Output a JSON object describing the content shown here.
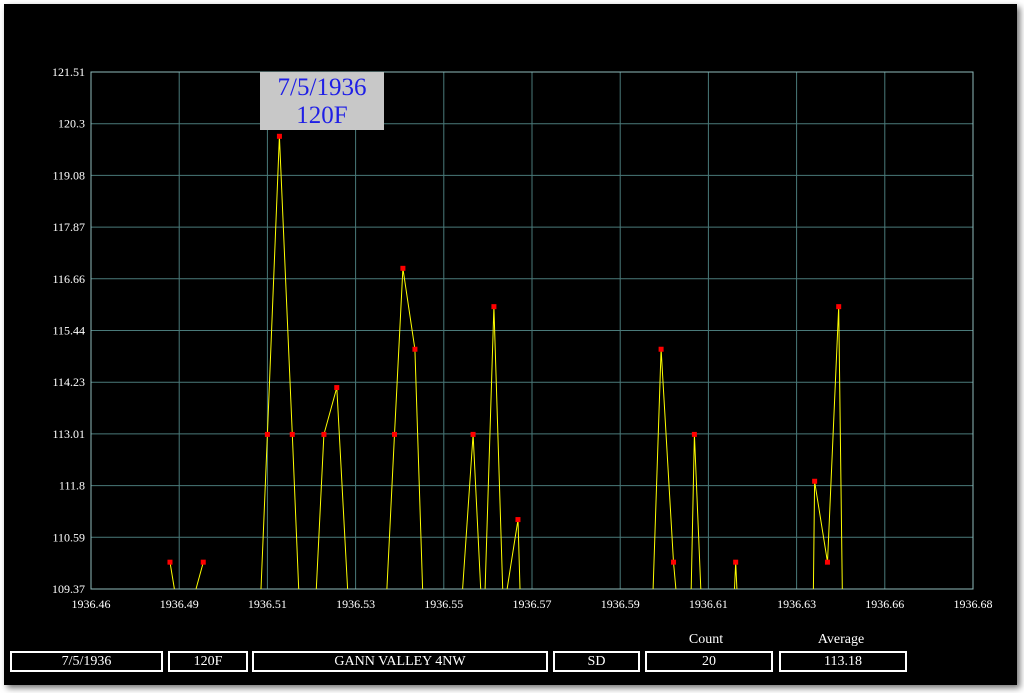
{
  "chart_data": {
    "type": "line",
    "title": "",
    "xlabel": "",
    "ylabel": "",
    "xlim": [
      1936.46,
      1936.68
    ],
    "ylim": [
      109.37,
      121.51
    ],
    "x_ticks": [
      "1936.46",
      "1936.49",
      "1936.51",
      "1936.53",
      "1936.55",
      "1936.57",
      "1936.59",
      "1936.61",
      "1936.63",
      "1936.66",
      "1936.68"
    ],
    "y_ticks": [
      "109.37",
      "110.59",
      "111.8",
      "113.01",
      "114.23",
      "115.44",
      "116.66",
      "117.87",
      "119.08",
      "120.3",
      "121.51"
    ],
    "grid": true,
    "line_color": "#ffff00",
    "marker_color": "#ff0000",
    "segments": [
      [
        {
          "x": 1936.4797,
          "y": 110.0
        },
        {
          "x": 1936.4808,
          "y": 109.37
        }
      ],
      [
        {
          "x": 1936.4862,
          "y": 109.37
        },
        {
          "x": 1936.488,
          "y": 110.0
        }
      ],
      [
        {
          "x": 1936.5024,
          "y": 109.37
        },
        {
          "x": 1936.504,
          "y": 113.0
        },
        {
          "x": 1936.507,
          "y": 120.0
        },
        {
          "x": 1936.5102,
          "y": 113.0
        },
        {
          "x": 1936.5118,
          "y": 109.37
        }
      ],
      [
        {
          "x": 1936.5162,
          "y": 109.37
        },
        {
          "x": 1936.5181,
          "y": 113.0
        },
        {
          "x": 1936.5213,
          "y": 114.1
        },
        {
          "x": 1936.524,
          "y": 109.37
        }
      ],
      [
        {
          "x": 1936.5338,
          "y": 109.37
        },
        {
          "x": 1936.5357,
          "y": 113.0
        },
        {
          "x": 1936.5378,
          "y": 116.9
        },
        {
          "x": 1936.5408,
          "y": 115.0
        },
        {
          "x": 1936.5427,
          "y": 109.37
        }
      ],
      [
        {
          "x": 1936.5527,
          "y": 109.37
        },
        {
          "x": 1936.5553,
          "y": 113.0
        },
        {
          "x": 1936.5572,
          "y": 109.37
        }
      ],
      [
        {
          "x": 1936.5583,
          "y": 109.37
        },
        {
          "x": 1936.5605,
          "y": 116.0
        },
        {
          "x": 1936.5627,
          "y": 109.37
        }
      ],
      [
        {
          "x": 1936.5638,
          "y": 109.37
        },
        {
          "x": 1936.5665,
          "y": 111.0
        },
        {
          "x": 1936.567,
          "y": 109.37
        }
      ],
      [
        {
          "x": 1936.6002,
          "y": 109.37
        },
        {
          "x": 1936.6022,
          "y": 115.0
        },
        {
          "x": 1936.6053,
          "y": 110.0
        },
        {
          "x": 1936.6059,
          "y": 109.37
        }
      ],
      [
        {
          "x": 1936.6097,
          "y": 109.37
        },
        {
          "x": 1936.6105,
          "y": 113.0
        },
        {
          "x": 1936.6121,
          "y": 109.37
        }
      ],
      [
        {
          "x": 1936.6205,
          "y": 109.37
        },
        {
          "x": 1936.6208,
          "y": 110.0
        },
        {
          "x": 1936.6211,
          "y": 109.37
        }
      ],
      [
        {
          "x": 1936.6402,
          "y": 109.37
        },
        {
          "x": 1936.6405,
          "y": 111.9
        },
        {
          "x": 1936.6437,
          "y": 110.0
        },
        {
          "x": 1936.6465,
          "y": 116.0
        },
        {
          "x": 1936.6474,
          "y": 109.37
        }
      ]
    ]
  },
  "tooltip": {
    "line1": "7/5/1936",
    "line2": "120F"
  },
  "footer": {
    "date": "7/5/1936",
    "temp": "120F",
    "station": "GANN VALLEY 4NW",
    "state": "SD",
    "count_label": "Count",
    "count": "20",
    "average_label": "Average",
    "average": "113.18"
  }
}
